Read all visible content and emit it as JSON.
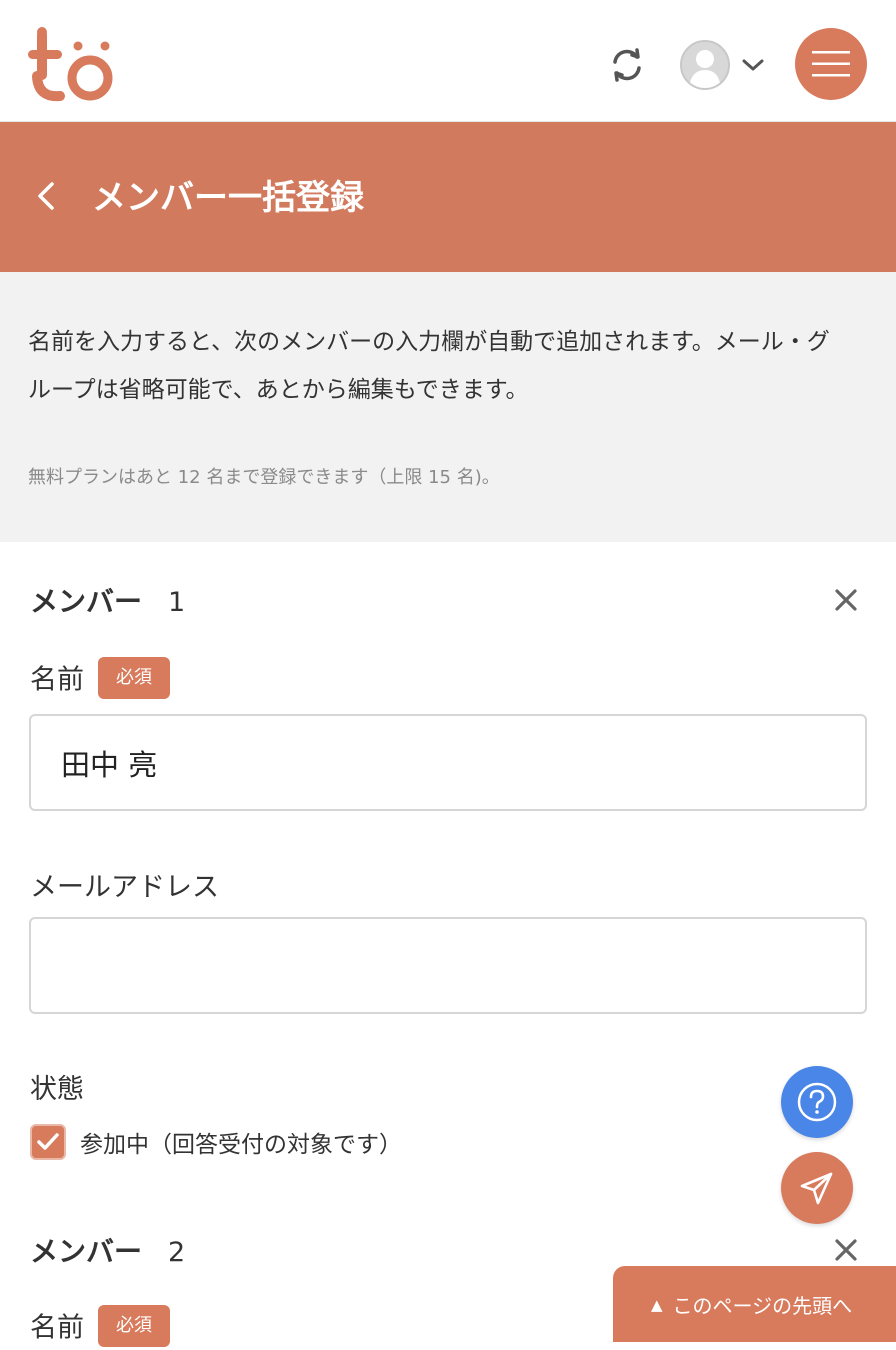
{
  "app": {
    "logo_text": "to",
    "brand_color": "#d87a5c"
  },
  "header": {
    "title": "メンバー一括登録"
  },
  "info": {
    "description": "名前を入力すると、次のメンバーの入力欄が自動で追加されます。メール・グループは省略可能で、あとから編集もできます。",
    "plan_note": "無料プランはあと 12 名まで登録できます（上限 15 名)。"
  },
  "members": [
    {
      "heading": "メンバー",
      "number": "1",
      "name_label": "名前",
      "required_badge": "必須",
      "name_value": "田中 亮",
      "email_label": "メールアドレス",
      "email_value": "",
      "status_label": "状態",
      "status_checked": true,
      "status_option": "参加中（回答受付の対象です）"
    },
    {
      "heading": "メンバー",
      "number": "2",
      "name_label": "名前",
      "required_badge": "必須"
    }
  ],
  "floating": {
    "page_top_arrow": "▲",
    "page_top_label": "このページの先頭へ"
  }
}
